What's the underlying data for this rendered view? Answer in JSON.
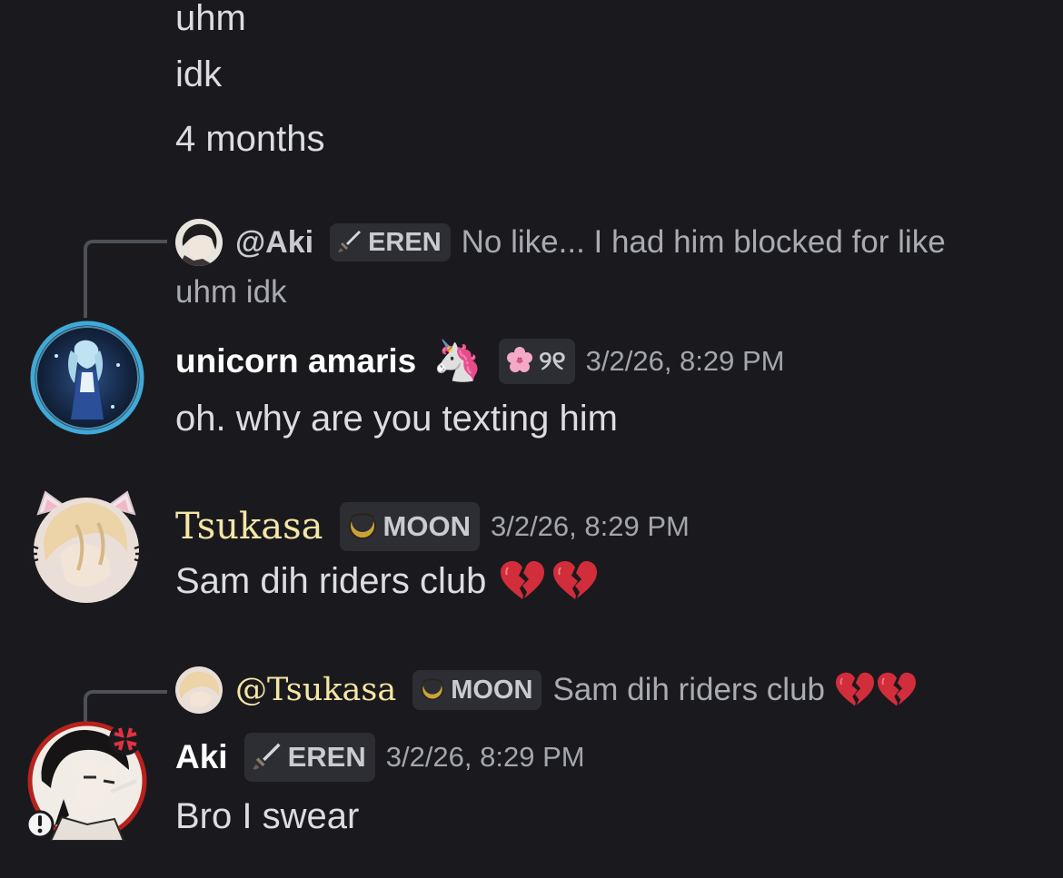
{
  "messages_top": {
    "lines": [
      "uhm",
      "idk",
      "4 months"
    ]
  },
  "message1": {
    "reply": {
      "mention": "@Aki",
      "tag_label": "EREN",
      "tag_icon": "sword-icon",
      "text_line1": "No like... I had him blocked for like",
      "text_line2": "uhm idk"
    },
    "author": "unicorn amaris",
    "author_emoji": "🦄",
    "tag_label": "୨୧",
    "tag_icon": "cherry-blossom-icon",
    "timestamp": "3/2/26, 8:29 PM",
    "text": "oh. why are you texting him"
  },
  "message2": {
    "author": "Tsukasa",
    "author_color": "#f5e6a6",
    "tag_label": "MOON",
    "tag_icon": "moon-icon",
    "timestamp": "3/2/26, 8:29 PM",
    "text": "Sam dih riders club"
  },
  "message3": {
    "reply": {
      "mention": "@Tsukasa",
      "mention_color": "#f5e6a6",
      "tag_label": "MOON",
      "tag_icon": "moon-icon",
      "text": "Sam dih riders club"
    },
    "author": "Aki",
    "tag_label": "EREN",
    "tag_icon": "sword-icon",
    "timestamp": "3/2/26, 8:29 PM",
    "text": "Bro I swear"
  },
  "colors": {
    "background": "#1a1a1e",
    "text": "#dcdde1",
    "muted": "#a3a6ad",
    "tag_bg": "#2d2e33",
    "heart": "#d12d3b"
  }
}
